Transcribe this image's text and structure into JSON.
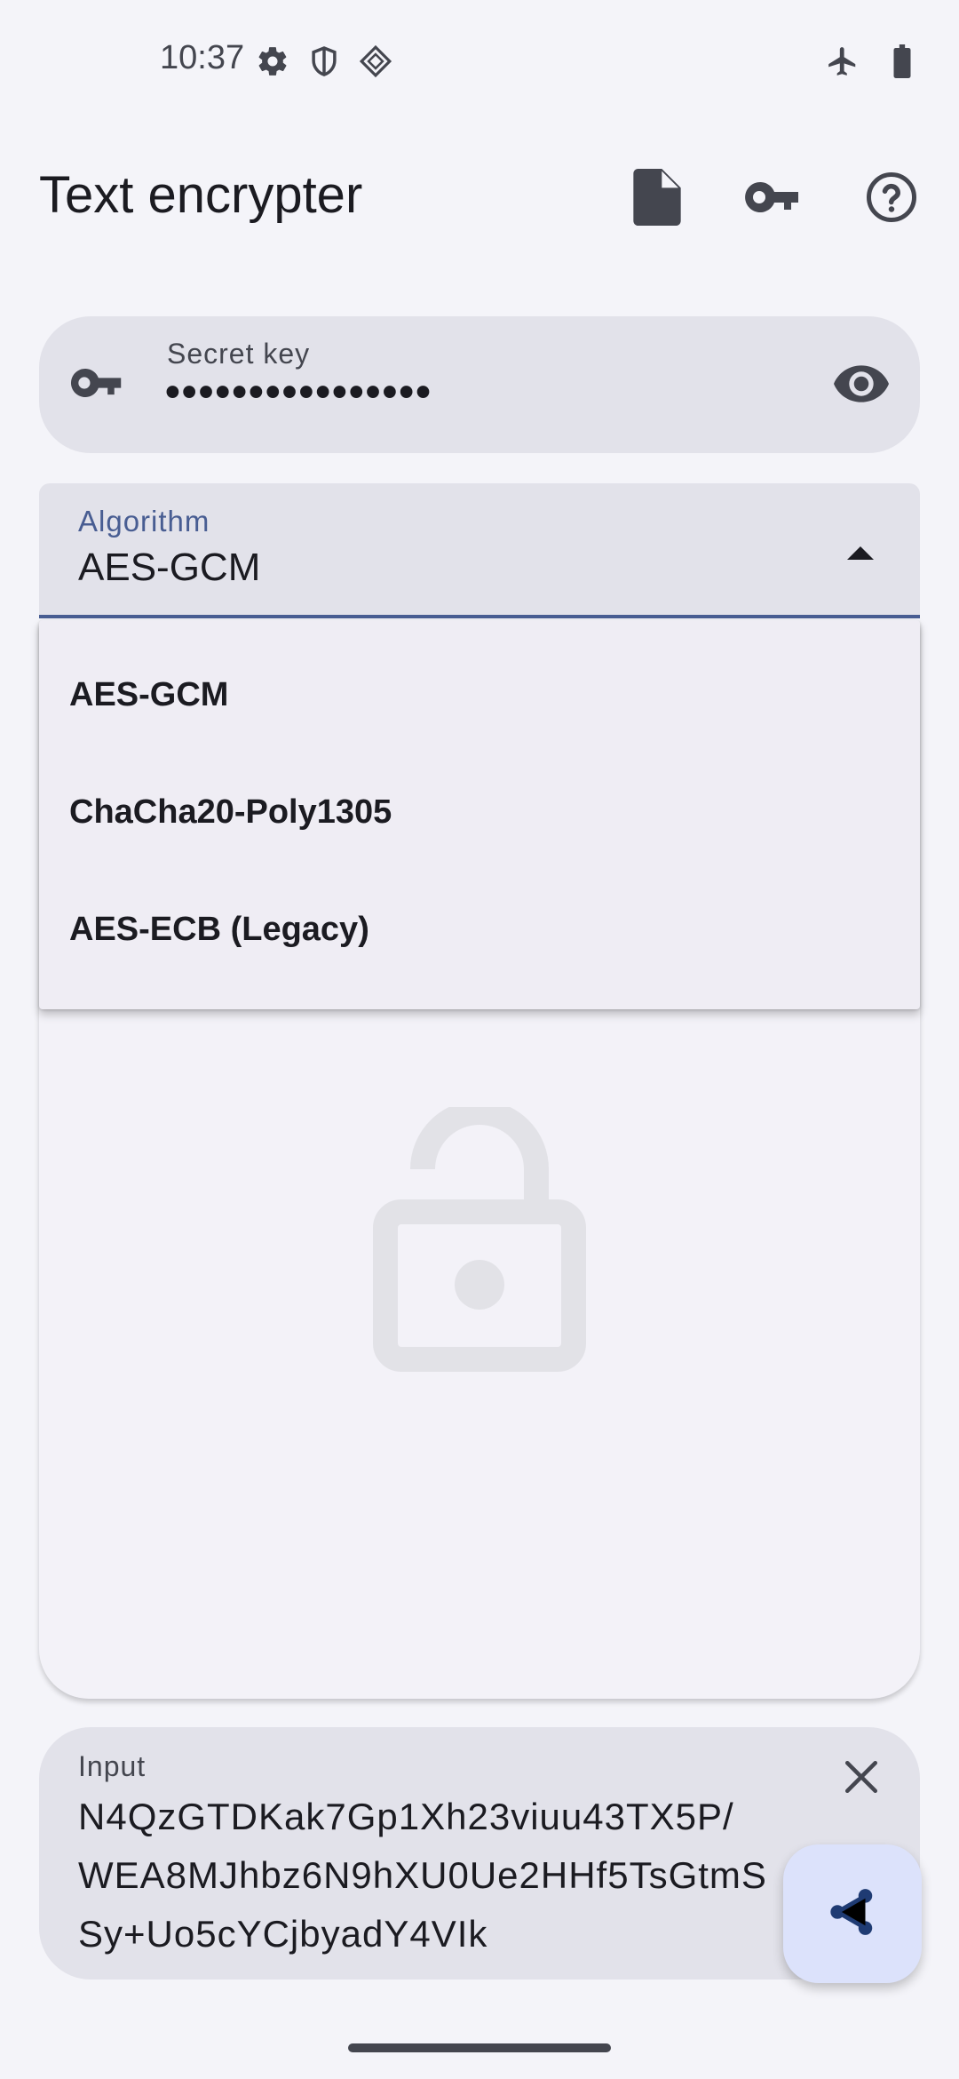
{
  "status_bar": {
    "time": "10:37",
    "left_icons": [
      "settings-icon",
      "shield-icon",
      "diamond-icon"
    ],
    "right_icons": [
      "airplane-icon",
      "battery-icon"
    ]
  },
  "app_bar": {
    "title": "Text encrypter",
    "actions": [
      "file-icon",
      "key-icon",
      "help-icon"
    ]
  },
  "secret_key": {
    "label": "Secret key",
    "value": "••••••••••••••••"
  },
  "algorithm": {
    "label": "Algorithm",
    "selected": "AES-GCM",
    "options": [
      "AES-GCM",
      "ChaCha20-Poly1305",
      "AES-ECB (Legacy)"
    ]
  },
  "input": {
    "label": "Input",
    "lines": [
      "N4QzGTDKak7Gp1Xh23viuu43TX5P/",
      "WEA8MJhbz6N9hXU0Ue2HHf5TsGtmS",
      "Sy+Uo5cYCjbyadY4VIk"
    ]
  },
  "colors": {
    "accent": "#485d92",
    "field_bg": "#e2e2ea",
    "fab_bg": "#dce2fb"
  }
}
